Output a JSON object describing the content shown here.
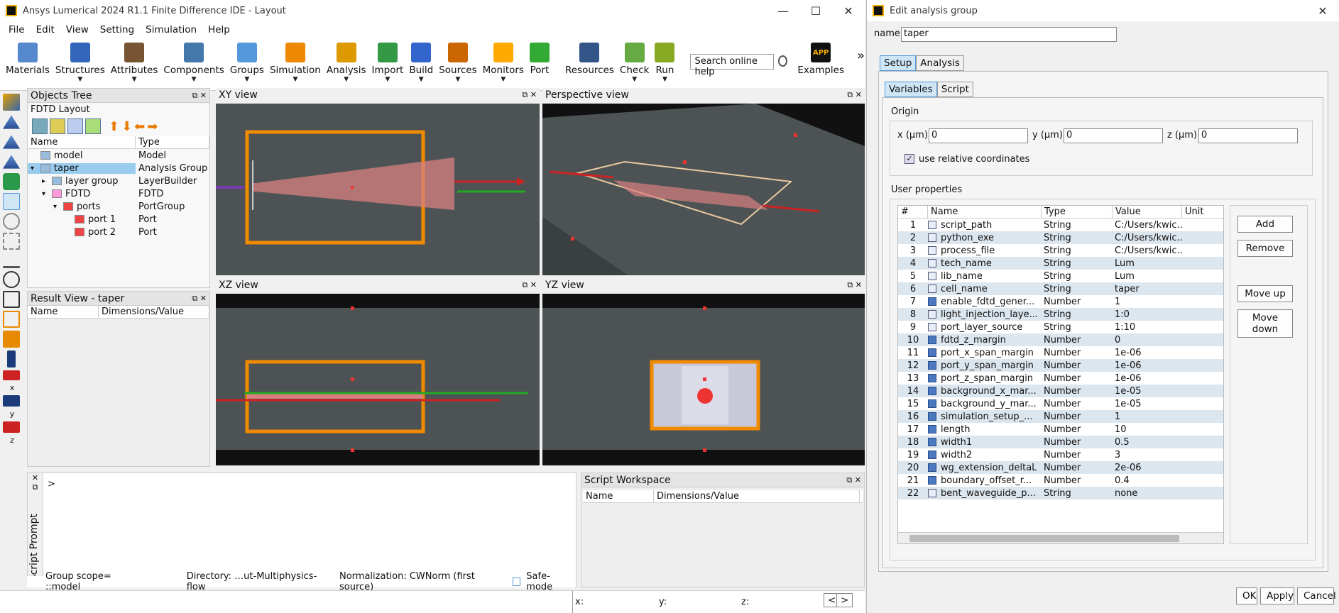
{
  "app": {
    "title": "Ansys Lumerical 2024 R1.1 Finite Difference IDE - Layout",
    "window_controls": [
      "—",
      "☐",
      "✕"
    ],
    "menu": [
      "File",
      "Edit",
      "View",
      "Setting",
      "Simulation",
      "Help"
    ],
    "toolbar": [
      {
        "label": "Materials",
        "icon": "materials-icon",
        "dropdown": false
      },
      {
        "label": "Structures",
        "icon": "structures-icon",
        "dropdown": true
      },
      {
        "label": "Attributes",
        "icon": "attributes-icon",
        "dropdown": true
      },
      {
        "label": "Components",
        "icon": "components-icon",
        "dropdown": true
      },
      {
        "label": "Groups",
        "icon": "groups-icon",
        "dropdown": true
      },
      {
        "label": "Simulation",
        "icon": "simulation-icon",
        "dropdown": true
      },
      {
        "label": "Analysis",
        "icon": "analysis-icon",
        "dropdown": true
      },
      {
        "label": "Import",
        "icon": "import-icon",
        "dropdown": true
      },
      {
        "label": "Build",
        "icon": "build-icon",
        "dropdown": true
      },
      {
        "label": "Sources",
        "icon": "sources-icon",
        "dropdown": true
      },
      {
        "label": "Monitors",
        "icon": "monitors-icon",
        "dropdown": true
      },
      {
        "label": "Port",
        "icon": "port-icon",
        "dropdown": false
      },
      {
        "label": "Resources",
        "icon": "resources-icon",
        "dropdown": false
      },
      {
        "label": "Check",
        "icon": "check-icon",
        "dropdown": true
      },
      {
        "label": "Run",
        "icon": "run-icon",
        "dropdown": true
      }
    ],
    "search_placeholder": "Search online help",
    "examples_label": "Examples",
    "examples_icon_text": "APP",
    "more_glyph": "»"
  },
  "objects_tree": {
    "title": "Objects Tree",
    "subtitle": "FDTD Layout",
    "columns": [
      "Name",
      "Type"
    ],
    "rows": [
      {
        "name": "model",
        "type": "Model",
        "indent": 0,
        "expander": "",
        "selected": false
      },
      {
        "name": "taper",
        "type": "Analysis Group",
        "indent": 0,
        "expander": "▾",
        "selected": true
      },
      {
        "name": "layer group",
        "type": "LayerBuilder",
        "indent": 1,
        "expander": "▸",
        "selected": false
      },
      {
        "name": "FDTD",
        "type": "FDTD",
        "indent": 1,
        "expander": "▾",
        "selected": false
      },
      {
        "name": "ports",
        "type": "PortGroup",
        "indent": 2,
        "expander": "▾",
        "selected": false
      },
      {
        "name": "port 1",
        "type": "Port",
        "indent": 3,
        "expander": "",
        "selected": false
      },
      {
        "name": "port 2",
        "type": "Port",
        "indent": 3,
        "expander": "",
        "selected": false
      }
    ]
  },
  "result_view": {
    "title": "Result View - taper",
    "columns": [
      "Name",
      "Dimensions/Value"
    ]
  },
  "views": {
    "xy": "XY view",
    "perspective": "Perspective view",
    "xz": "XZ view",
    "yz": "YZ view"
  },
  "script_prompt": {
    "label": "Script Prompt",
    "prompt": ">",
    "axis_labels": [
      "x",
      "y",
      "z"
    ]
  },
  "script_workspace": {
    "title": "Script Workspace",
    "columns": [
      "Name",
      "Dimensions/Value"
    ]
  },
  "statusbar": {
    "group_scope": "Group scope= ::model",
    "directory": "Directory: …ut-Multiphysics-flow",
    "normalization": "Normalization: CWNorm (first source)",
    "safe_mode": "Safe-mode",
    "x": "x:",
    "y": "y:",
    "z": "z:",
    "prev": "<",
    "next": ">"
  },
  "dialog": {
    "title": "Edit analysis group",
    "close_glyph": "✕",
    "name_label": "name",
    "name_value": "taper",
    "tabs": [
      "Setup",
      "Analysis"
    ],
    "subtabs": [
      "Variables",
      "Script"
    ],
    "origin": {
      "label": "Origin",
      "x_label": "x (μm)",
      "x_value": "0",
      "y_label": "y (μm)",
      "y_value": "0",
      "z_label": "z (μm)",
      "z_value": "0",
      "relative_label": "use relative coordinates",
      "relative_checked": true
    },
    "user_properties_label": "User properties",
    "prop_columns": [
      "#",
      "Name",
      "Type",
      "Value",
      "Unit"
    ],
    "props": [
      {
        "n": "1",
        "name": "script_path",
        "type": "String",
        "value": "C:/Users/kwic..."
      },
      {
        "n": "2",
        "name": "python_exe",
        "type": "String",
        "value": "C:/Users/kwic..."
      },
      {
        "n": "3",
        "name": "process_file",
        "type": "String",
        "value": "C:/Users/kwic..."
      },
      {
        "n": "4",
        "name": "tech_name",
        "type": "String",
        "value": "Lum"
      },
      {
        "n": "5",
        "name": "lib_name",
        "type": "String",
        "value": "Lum"
      },
      {
        "n": "6",
        "name": "cell_name",
        "type": "String",
        "value": "taper"
      },
      {
        "n": "7",
        "name": "enable_fdtd_gener...",
        "type": "Number",
        "value": "1"
      },
      {
        "n": "8",
        "name": "light_injection_laye...",
        "type": "String",
        "value": "1:0"
      },
      {
        "n": "9",
        "name": "port_layer_source",
        "type": "String",
        "value": "1:10"
      },
      {
        "n": "10",
        "name": "fdtd_z_margin",
        "type": "Number",
        "value": "0"
      },
      {
        "n": "11",
        "name": "port_x_span_margin",
        "type": "Number",
        "value": "1e-06"
      },
      {
        "n": "12",
        "name": "port_y_span_margin",
        "type": "Number",
        "value": "1e-06"
      },
      {
        "n": "13",
        "name": "port_z_span_margin",
        "type": "Number",
        "value": "1e-06"
      },
      {
        "n": "14",
        "name": "background_x_mar...",
        "type": "Number",
        "value": "1e-05"
      },
      {
        "n": "15",
        "name": "background_y_mar...",
        "type": "Number",
        "value": "1e-05"
      },
      {
        "n": "16",
        "name": "simulation_setup_...",
        "type": "Number",
        "value": "1"
      },
      {
        "n": "17",
        "name": "length",
        "type": "Number",
        "value": "10"
      },
      {
        "n": "18",
        "name": "width1",
        "type": "Number",
        "value": "0.5"
      },
      {
        "n": "19",
        "name": "width2",
        "type": "Number",
        "value": "3"
      },
      {
        "n": "20",
        "name": "wg_extension_deltaL",
        "type": "Number",
        "value": "2e-06"
      },
      {
        "n": "21",
        "name": "boundary_offset_r...",
        "type": "Number",
        "value": "0.4"
      },
      {
        "n": "22",
        "name": "bent_waveguide_p...",
        "type": "String",
        "value": "none"
      }
    ],
    "buttons": {
      "add": "Add",
      "remove": "Remove",
      "move_up": "Move up",
      "move_down": "Move down",
      "ok": "OK",
      "apply": "Apply",
      "cancel": "Cancel"
    }
  },
  "colors": {
    "accent": "#5599dd",
    "selected_row": "#99ccee",
    "view_bg": "#4d5354",
    "orange": "#f08a00",
    "red": "#e03030"
  }
}
